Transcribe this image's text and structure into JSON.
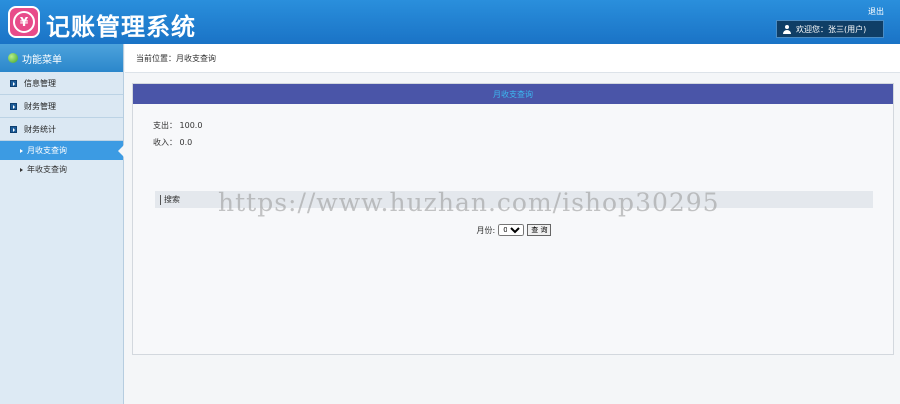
{
  "header": {
    "logo_glyph": "¥",
    "app_title": "记账管理系统",
    "logout_label": "退出",
    "user_label": "欢迎您：张三(用户)"
  },
  "sidebar": {
    "menu_title": "功能菜单",
    "items": [
      {
        "label": "信息管理",
        "icon": "square-arrow-icon"
      },
      {
        "label": "财务管理",
        "icon": "square-arrow-icon"
      },
      {
        "label": "财务统计",
        "icon": "square-arrow-icon"
      }
    ],
    "sub_items": [
      {
        "label": "月收支查询",
        "active": true
      },
      {
        "label": "年收支查询",
        "active": false
      }
    ]
  },
  "breadcrumb": "当前位置：月收支查询",
  "panel": {
    "title": "月收支查询",
    "expense": "支出：  100.0",
    "income": "收入：  0.0",
    "search_label": "搜索",
    "month_label": "月份:",
    "month_value": "01",
    "query_button": "查 询"
  },
  "watermark": "https://www.huzhan.com/ishop30295",
  "colors": {
    "header": "#1a73c6",
    "panel_title_bg": "#4a55a8",
    "active_item": "#3c9be3"
  }
}
